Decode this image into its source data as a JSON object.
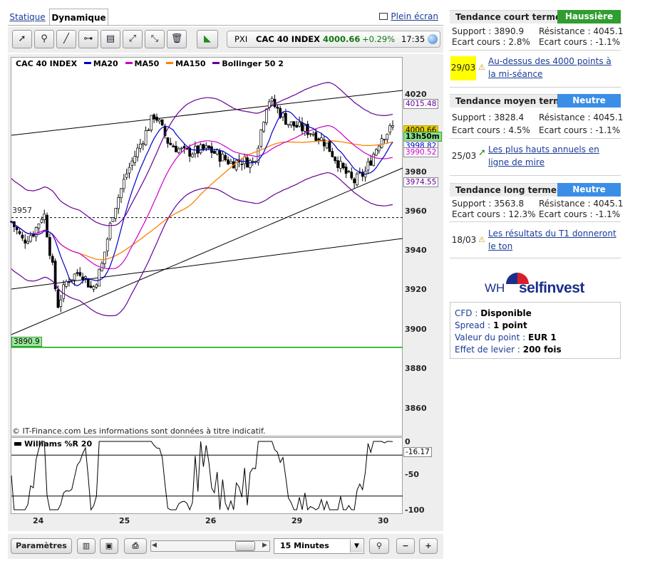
{
  "tabs": {
    "static": "Statique",
    "dynamic": "Dynamique"
  },
  "fullscreen_label": "Plein écran",
  "toolbar_icons": [
    "cursor-icon",
    "zoom-icon",
    "line-icon",
    "horizontal-line-icon",
    "indicator-icon",
    "fibonacci-icon",
    "channel-icon",
    "trash-icon",
    "chart-type-icon"
  ],
  "ticker": {
    "code": "PXI",
    "name": "CAC 40 INDEX",
    "price": "4000.66",
    "change": "+0.29%",
    "time": "17:35"
  },
  "chart_legend": {
    "instrument": "CAC 40 INDEX",
    "ma20": "MA20",
    "ma50": "MA50",
    "ma150": "MA150",
    "bollinger": "Bollinger 50 2"
  },
  "colors": {
    "ma20": "#0000cc",
    "ma50": "#cc00cc",
    "ma150": "#ff8000",
    "bollinger": "#660099",
    "support_line": "#00aa00",
    "bullish_badge": "#2f9d2f",
    "neutral_badge": "#3b8ee6",
    "news_highlight": "#ffff00"
  },
  "chart_data": {
    "type": "candlestick",
    "instrument": "CAC 40 INDEX",
    "interval": "15 Minutes",
    "x_ticks": [
      "24",
      "25",
      "26",
      "29",
      "30"
    ],
    "y_ticks": [
      4020,
      3980,
      3960,
      3940,
      3920,
      3900,
      3880,
      3860
    ],
    "y_range": [
      3850,
      4025
    ],
    "last_price": "4000.66",
    "timer_tag": "13h50m",
    "tags": {
      "bollinger_upper": "4015.48",
      "ma20": "3998.82",
      "ma50": "3990.52",
      "bollinger_lower": "3974.55",
      "support": "3890.9",
      "dashed_level": "3957"
    },
    "williams": {
      "label": "Williams %R 20",
      "ticks": [
        "0",
        "-50",
        "-100"
      ],
      "last": "-16.17",
      "range": [
        -100,
        0
      ]
    },
    "copyright": "© IT-Finance.com Les informations sont données à titre indicatif."
  },
  "bottom": {
    "params_button": "Paramètres",
    "interval_select": "15 Minutes"
  },
  "trends": {
    "short": {
      "title": "Tendance court terme",
      "badge": "Haussière",
      "support": "Support : 3890.9",
      "resistance": "Résistance : 4045.1",
      "gap_support": "Ecart cours : 2.8%",
      "gap_resistance": "Ecart cours : -1.1%"
    },
    "medium": {
      "title": "Tendance moyen terme",
      "badge": "Neutre",
      "support": "Support : 3828.4",
      "resistance": "Résistance : 4045.1",
      "gap_support": "Ecart cours : 4.5%",
      "gap_resistance": "Ecart cours : -1.1%"
    },
    "long": {
      "title": "Tendance long terme",
      "badge": "Neutre",
      "support": "Support : 3563.8",
      "resistance": "Résistance : 4045.1",
      "gap_support": "Ecart cours : 12.3%",
      "gap_resistance": "Ecart cours : -1.1%"
    }
  },
  "news": [
    {
      "date": "29/03",
      "text": "Au-dessus des 4000 points à la mi-séance",
      "icon": "warning-icon"
    },
    {
      "date": "25/03",
      "text": "Les plus hauts annuels en ligne de mire",
      "icon": "arrow-up-icon"
    },
    {
      "date": "18/03",
      "text": "Les résultats du T1 donneront le ton",
      "icon": "warning-icon"
    }
  ],
  "broker": {
    "logo_prefix": "WH",
    "logo_name": "selfinvest",
    "rows": [
      {
        "label": "CFD : ",
        "value": "Disponible"
      },
      {
        "label": "Spread : ",
        "value": "1 point"
      },
      {
        "label": "Valeur du point : ",
        "value": "EUR 1"
      },
      {
        "label": "Effet de levier : ",
        "value": "200 fois"
      }
    ]
  }
}
